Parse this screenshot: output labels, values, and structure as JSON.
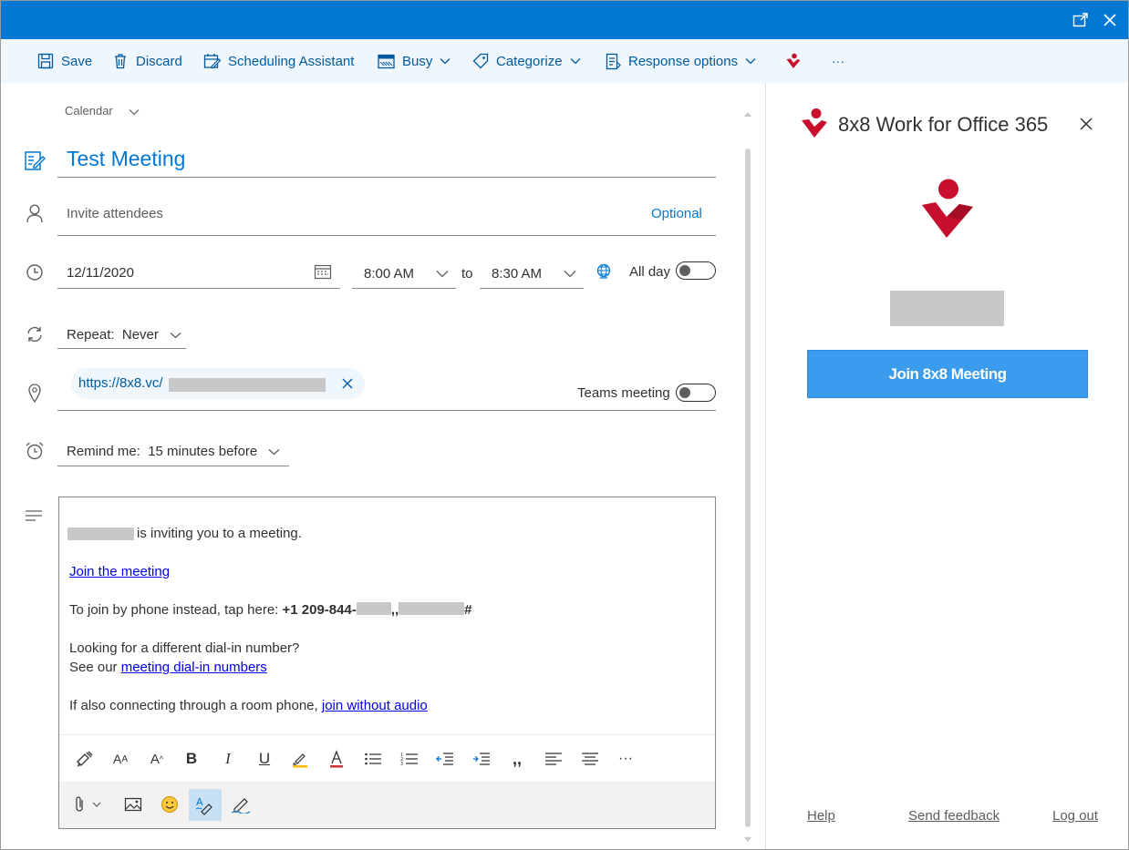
{
  "toolbar": {
    "save": "Save",
    "discard": "Discard",
    "scheduling": "Scheduling Assistant",
    "busy": "Busy",
    "categorize": "Categorize",
    "response": "Response options",
    "more": "···"
  },
  "form": {
    "calendar_label": "Calendar",
    "title": "Test Meeting",
    "attendees_placeholder": "Invite attendees",
    "optional": "Optional",
    "date": "12/11/2020",
    "start_time": "8:00 AM",
    "to": "to",
    "end_time": "8:30 AM",
    "all_day": "All day",
    "repeat": "Repeat:  Never",
    "location_chip": "https://8x8.vc/",
    "teams_meeting": "Teams meeting",
    "remind": "Remind me:  15 minutes before"
  },
  "body": {
    "inviting": "is inviting you to a meeting.",
    "join_link": "Join the meeting",
    "phone_prefix": "To join by phone instead, tap here: ",
    "phone_bold": "+1 209-844-",
    "phone_comma": ",,",
    "phone_hash": "#",
    "looking": "Looking for a different dial-in number?",
    "see_our": "See our ",
    "dialin_link": "meeting dial-in numbers",
    "room_prefix": "If also connecting through a room phone, ",
    "room_link": "join without audio"
  },
  "pane": {
    "title": "8x8 Work for Office 365",
    "join_button": "Join 8x8 Meeting",
    "help": "Help",
    "feedback": "Send feedback",
    "logout": "Log out"
  },
  "colors": {
    "titlebar": "#0078d4",
    "toolbar_bg": "#eff6fc",
    "accent": "#0078d4",
    "brand_red": "#c8102e",
    "join_button": "#3b9cee"
  }
}
